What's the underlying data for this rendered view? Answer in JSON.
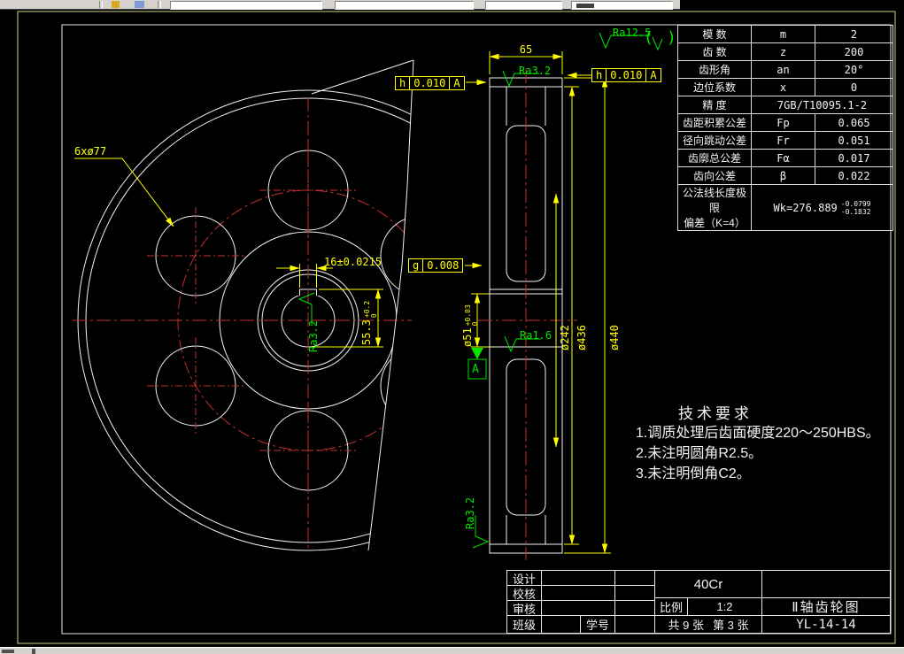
{
  "param_table": {
    "rows": [
      {
        "name": "模  数",
        "symbol": "m",
        "value": "2"
      },
      {
        "name": "齿  数",
        "symbol": "z",
        "value": "200"
      },
      {
        "name": "齿形角",
        "symbol": "an",
        "value": "20°"
      },
      {
        "name": "边位系数",
        "symbol": "x",
        "value": "0"
      },
      {
        "name": "精  度",
        "symbol": "",
        "value": "7GB/T10095.1-2"
      },
      {
        "name": "齿距积累公差",
        "symbol": "Fp",
        "value": "0.065"
      },
      {
        "name": "径向跳动公差",
        "symbol": "Fr",
        "value": "0.051"
      },
      {
        "name": "齿廓总公差",
        "symbol": "Fα",
        "value": "0.017"
      },
      {
        "name": "齿向公差",
        "symbol": "β",
        "value": "0.022"
      }
    ],
    "wk": {
      "label1": "公法线长度极限",
      "label2": "偏差（K=4）",
      "value": "Wk=276.889",
      "upper": "-0.0799",
      "lower": "-0.1832"
    }
  },
  "tech_req": {
    "title": "技术要求",
    "items": [
      "1.调质处理后齿面硬度220～250HBS。",
      "2.未注明圆角R2.5。",
      "3.未注明倒角C2。"
    ]
  },
  "title_block": {
    "design": "设计",
    "check": "校核",
    "review": "审核",
    "class": "班级",
    "student": "学号",
    "material": "40Cr",
    "scale_label": "比例",
    "scale": "1:2",
    "sheets_total": "共 9 张",
    "sheet_no": "第 3 张",
    "title": "Ⅱ轴齿轮图",
    "code": "YL-14-14"
  },
  "dims": {
    "face_width": "65",
    "holes": "6xø77",
    "keyway_width": "16±0.0215",
    "keyway_height": "55.3",
    "keyway_tol_up": "+0.2",
    "keyway_tol_dn": "0",
    "bore": "ø51",
    "bore_tol_up": "+0.03",
    "bore_tol_dn": "0",
    "dia_web": "ø242",
    "dia_root": "ø436",
    "dia_tip": "ø440"
  },
  "gdt": {
    "left": {
      "sym": "h",
      "tol": "0.010",
      "datum": "A"
    },
    "right": {
      "sym": "h",
      "tol": "0.010",
      "datum": "A"
    },
    "symmetry": {
      "sym": "g",
      "tol": "0.008"
    },
    "datum": "A"
  },
  "rough": {
    "general": "Ra12.5",
    "paren_open": "(",
    "paren_close": ")",
    "face_top": "Ra3.2",
    "bore": "Ra1.6",
    "keyway": "Ra3.2",
    "face_bottom": "Ra3.2"
  }
}
